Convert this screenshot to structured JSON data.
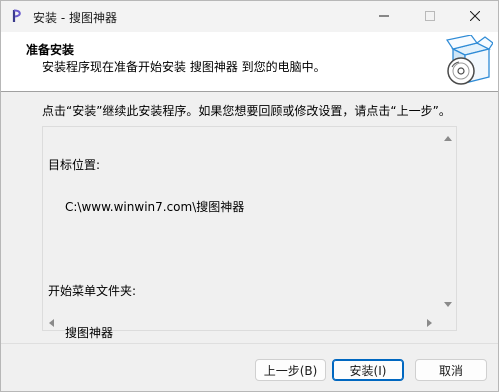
{
  "window": {
    "title": "安装 - 搜图神器",
    "icons": {
      "app": "app-icon",
      "minimize": "minimize-icon",
      "maximize": "maximize-icon",
      "close": "close-icon"
    }
  },
  "header": {
    "title": "准备安装",
    "subtitle": "安装程序现在准备开始安装 搜图神器 到您的电脑中。",
    "art_icon": "installer-box-disc-icon"
  },
  "body": {
    "instructions": "点击“安装”继续此安装程序。如果您想要回顾或修改设置，请点击“上一步”。",
    "memo": {
      "dest_label": "目标位置:",
      "dest_value": "C:\\www.winwin7.com\\搜图神器",
      "menu_label": "开始菜单文件夹:",
      "menu_value": "搜图神器"
    }
  },
  "buttons": {
    "back": "上一步(B)",
    "install": "安装(I)",
    "cancel": "取消"
  },
  "colors": {
    "accent": "#0067c0",
    "window_bg": "#f0f0f0",
    "header_bg": "#ffffff"
  }
}
